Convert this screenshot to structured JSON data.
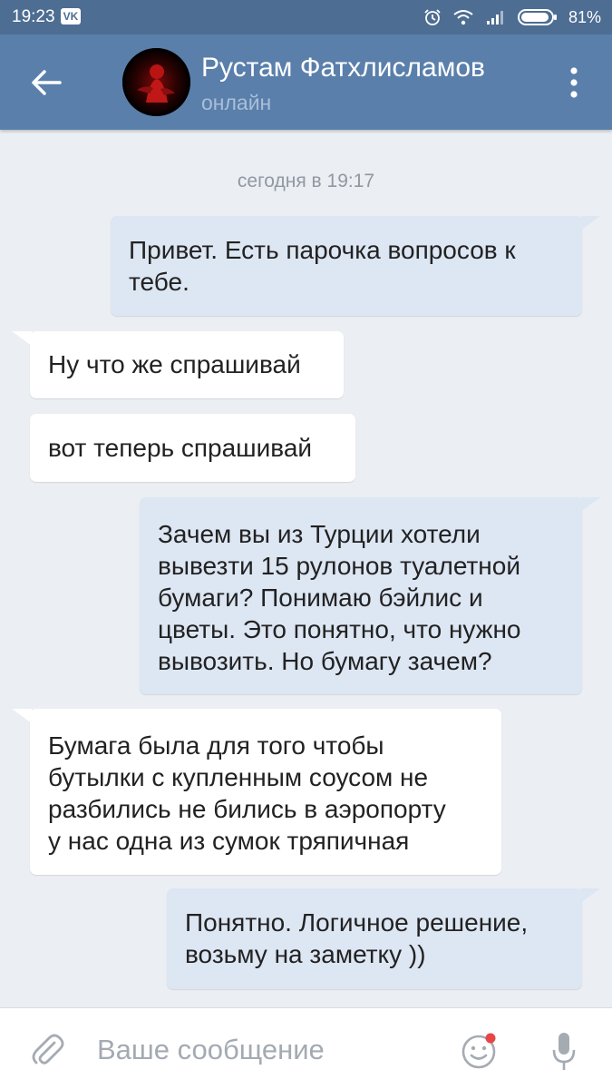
{
  "status_bar": {
    "time": "19:23",
    "app_badge": "VK",
    "battery_percent": "81%",
    "icons": [
      "alarm-icon",
      "wifi-icon",
      "signal-icon",
      "battery-icon"
    ]
  },
  "header": {
    "contact_name": "Рустам Фатхлисламов",
    "presence": "онлайн",
    "icons": [
      "back-arrow-icon",
      "more-vert-icon"
    ]
  },
  "chat": {
    "date_separator": "сегодня в 19:17",
    "messages": [
      {
        "direction": "out",
        "lines": [
          "Привет. Есть парочка вопросов к",
          "тебе."
        ]
      },
      {
        "direction": "in",
        "lines": [
          "Ну что же спрашивай"
        ]
      },
      {
        "direction": "in",
        "lines": [
          "вот теперь спрашивай"
        ]
      },
      {
        "direction": "out",
        "lines": [
          "Зачем вы из Турции хотели",
          "вывезти 15 рулонов туалетной",
          "бумаги? Понимаю бэйлис и",
          "цветы. Это понятно, что нужно",
          "вывозить. Но бумагу зачем?"
        ]
      },
      {
        "direction": "in",
        "lines": [
          "Бумага была для того чтобы",
          "бутылки с купленным соусом не",
          "разбились не бились в аэропорту",
          "у нас одна из сумок тряпичная"
        ]
      },
      {
        "direction": "out",
        "lines": [
          "Понятно. Логичное решение,",
          "возьму на заметку ))"
        ]
      }
    ]
  },
  "input_bar": {
    "placeholder": "Ваше сообщение",
    "value": "",
    "icons": [
      "paperclip-icon",
      "emoji-icon",
      "microphone-icon"
    ]
  },
  "colors": {
    "header_bg": "#5a7fab",
    "status_bar_bg": "#4d6d92",
    "chat_bg": "#ebeef2",
    "outgoing_bubble": "#dde6f3",
    "incoming_bubble": "#ffffff",
    "emoji_notification_dot": "#e64646"
  }
}
